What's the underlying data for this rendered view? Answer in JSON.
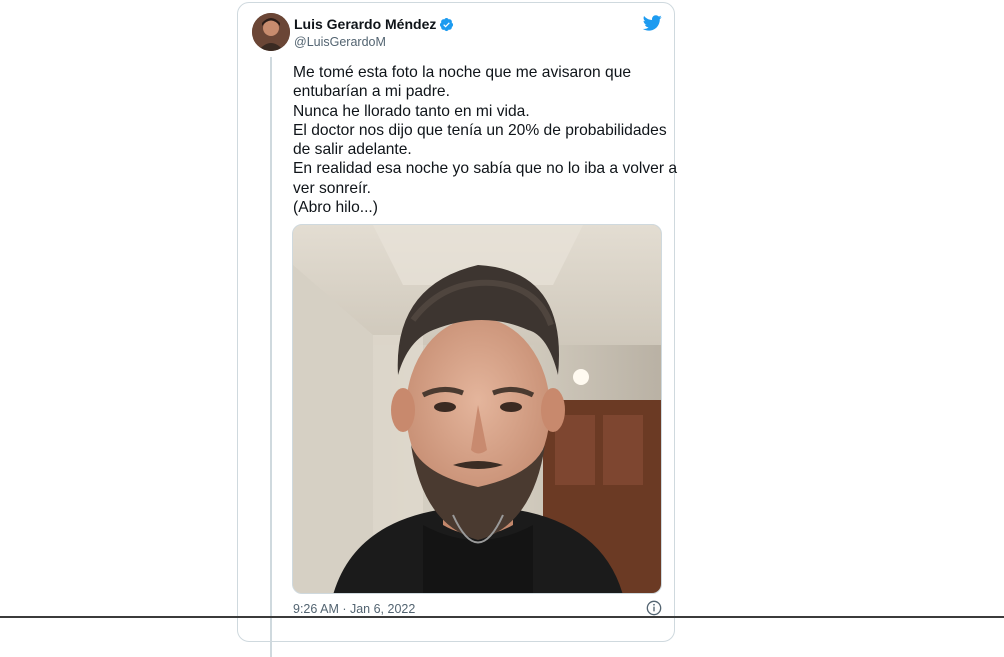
{
  "author": {
    "name": "Luis Gerardo Méndez",
    "handle": "@LuisGerardoM",
    "verified": true
  },
  "tweet": {
    "lines": [
      "Me tomé esta foto la noche que me avisaron que",
      "entubarían a mi padre.",
      "Nunca he llorado tanto en mi vida.",
      "El doctor nos dijo que tenía un 20% de probabilidades",
      "de salir adelante.",
      "En realidad esa noche yo sabía que no lo iba a volver a",
      "ver sonreír.",
      "(Abro hilo...)"
    ],
    "timestamp": "9:26 AM · Jan 6, 2022"
  },
  "icons": {
    "brand": "twitter-bird-icon",
    "verified": "verified-badge-icon",
    "info": "info-icon"
  },
  "colors": {
    "brand_blue": "#1d9bf0",
    "text_primary": "#0f1419",
    "text_secondary": "#536471",
    "border": "#cfd9de"
  }
}
